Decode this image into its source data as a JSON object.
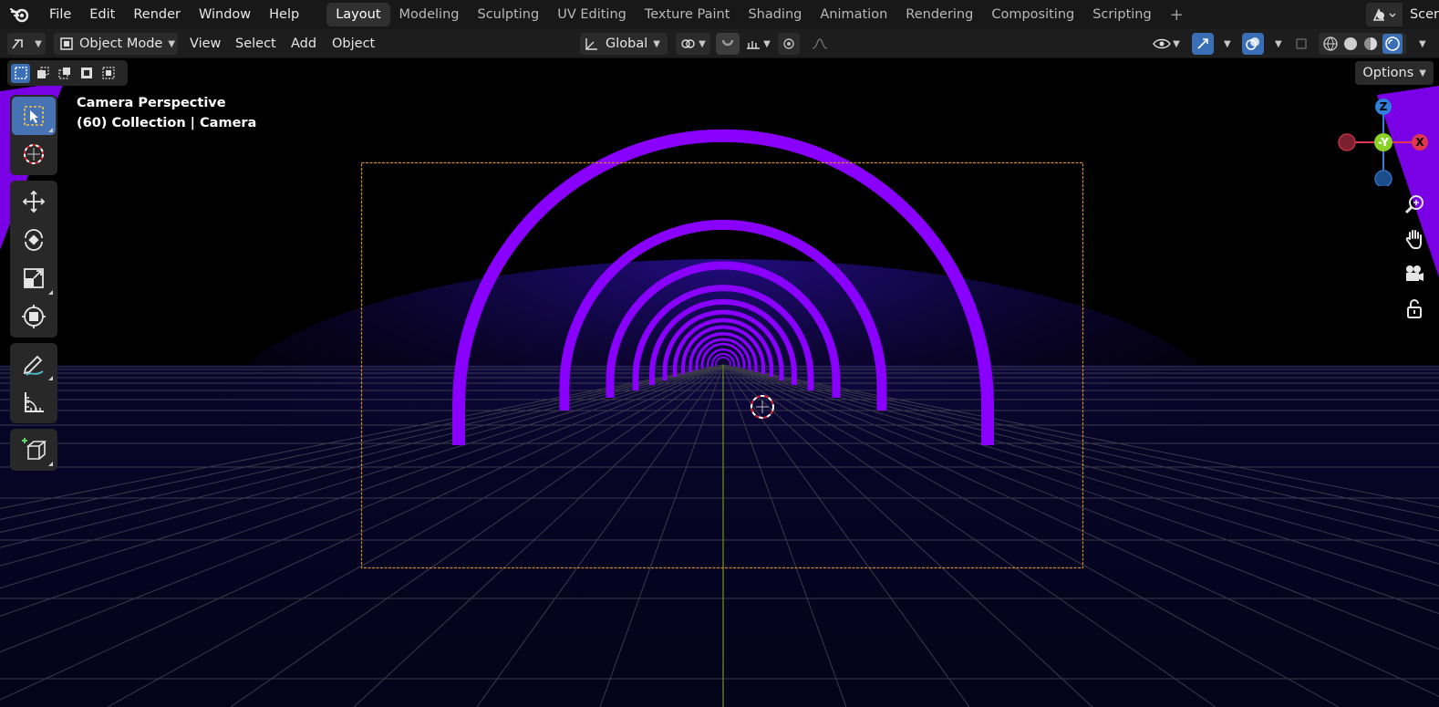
{
  "menu": {
    "items": [
      "File",
      "Edit",
      "Render",
      "Window",
      "Help"
    ]
  },
  "workspaces": {
    "tabs": [
      "Layout",
      "Modeling",
      "Sculpting",
      "UV Editing",
      "Texture Paint",
      "Shading",
      "Animation",
      "Rendering",
      "Compositing",
      "Scripting"
    ],
    "active": "Layout"
  },
  "scene": {
    "label": "Scer"
  },
  "viewport_header": {
    "mode": "Object Mode",
    "menus": [
      "View",
      "Select",
      "Add",
      "Object"
    ],
    "transform_orientation": "Global"
  },
  "viewport": {
    "perspective_label": "Camera Perspective",
    "collection_label": "(60) Collection | Camera",
    "options_label": "Options"
  },
  "gizmo": {
    "z": "Z",
    "y": "-Y",
    "x": "X"
  },
  "colors": {
    "accent": "#4772b3",
    "arch": "#8a00ff",
    "camera_frame": "#d28a2a",
    "axis_x": "#e0364f",
    "axis_y": "#8ad12a",
    "axis_z": "#2f7ed8"
  }
}
